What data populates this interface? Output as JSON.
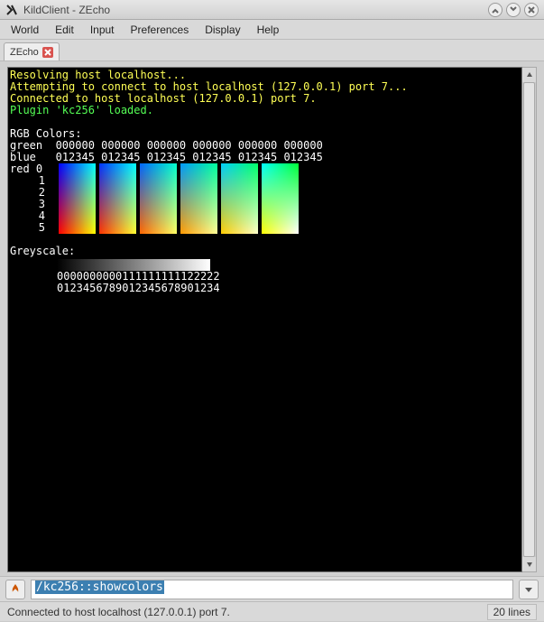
{
  "window": {
    "title": "KildClient - ZEcho"
  },
  "menu": {
    "items": [
      "World",
      "Edit",
      "Input",
      "Preferences",
      "Display",
      "Help"
    ]
  },
  "tab": {
    "label": "ZEcho"
  },
  "terminal": {
    "lines_connect": [
      "Resolving host localhost...",
      "Attempting to connect to host localhost (127.0.0.1) port 7...",
      "Connected to host localhost (127.0.0.1) port 7."
    ],
    "plugin_line": "Plugin 'kc256' loaded.",
    "rgb_header": "RGB Colors:",
    "rgb_green_label": "green",
    "rgb_green_vals": "000000 000000 000000 000000 000000 000000",
    "rgb_blue_label": "blue",
    "rgb_blue_vals": "012345 012345 012345 012345 012345 012345",
    "rgb_red_label": "red",
    "rgb_red_rows": [
      "0",
      "1",
      "2",
      "3",
      "4",
      "5"
    ],
    "greyscale_header": "Greyscale:",
    "grey_row1": "0000000000111111111122222",
    "grey_row2": "0123456789012345678901234"
  },
  "input": {
    "command": "/kc256::showcolors"
  },
  "status": {
    "left": "Connected to host localhost (127.0.0.1) port 7.",
    "right": "20 lines"
  },
  "rgb_blocks": [
    {
      "tl": "#0000ff",
      "tr": "#00ffff",
      "bl": "#ff0000",
      "br": "#ffff00"
    },
    {
      "tl": "#0033ff",
      "tr": "#00ffff",
      "bl": "#ff3300",
      "br": "#ffff33"
    },
    {
      "tl": "#0066ff",
      "tr": "#00ffcc",
      "bl": "#ff6600",
      "br": "#ffff66"
    },
    {
      "tl": "#0099ff",
      "tr": "#00ff99",
      "bl": "#ff9900",
      "br": "#ffff99"
    },
    {
      "tl": "#00ccff",
      "tr": "#00ff66",
      "bl": "#ffcc00",
      "br": "#ffffcc"
    },
    {
      "tl": "#00ffff",
      "tr": "#00ff33",
      "bl": "#ffff00",
      "br": "#ffffff"
    }
  ]
}
